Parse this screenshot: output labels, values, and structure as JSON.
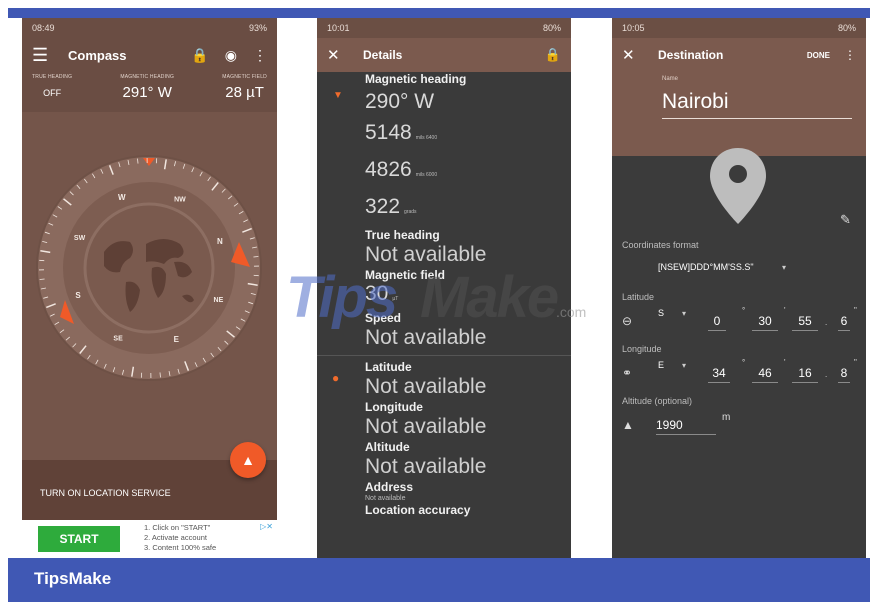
{
  "colors": {
    "frame_blue": "#4058b4",
    "compass_brown": "#74554a",
    "header_brown": "#7b5a4e",
    "dark_panel": "#3a3a3a",
    "accent_orange": "#f05a28",
    "ad_green": "#2eab3c"
  },
  "compass_screen": {
    "status": {
      "time": "08:49",
      "battery": "93%"
    },
    "appbar": {
      "title": "Compass",
      "menu_icon": "menu-icon",
      "lock_icon": "lock-icon",
      "pin_icon": "location-pin-icon",
      "more_icon": "more-icon"
    },
    "metrics": [
      {
        "label": "TRUE HEADING",
        "value": "OFF"
      },
      {
        "label": "MAGNETIC HEADING",
        "value": "291° W"
      },
      {
        "label": "MAGNETIC FIELD",
        "value": "28 µT"
      }
    ],
    "dial": {
      "heading_deg": 291,
      "cardinals": [
        "N",
        "NE",
        "E",
        "SE",
        "S",
        "SW",
        "W",
        "NW"
      ]
    },
    "location_banner": "TURN ON LOCATION SERVICE",
    "fab_icon": "navigation-arrow-icon",
    "ad": {
      "button": "START",
      "steps": [
        "1. Click on \"START\"",
        "2. Activate account",
        "3. Content 100% safe"
      ]
    }
  },
  "details_screen": {
    "status": {
      "time": "10:01",
      "battery": "80%"
    },
    "appbar": {
      "title": "Details",
      "close_icon": "close-icon",
      "lock_icon": "lock-icon"
    },
    "magnetic_heading": {
      "title": "Magnetic heading",
      "value": "290° W",
      "mils6400": "5148",
      "mils6400_unit": "mils 6400",
      "mils6000": "4826",
      "mils6000_unit": "mils 6000",
      "grads": "322",
      "grads_unit": "grads"
    },
    "true_heading": {
      "title": "True heading",
      "value": "Not available"
    },
    "magnetic_field": {
      "title": "Magnetic field",
      "value": "30",
      "unit": "µT"
    },
    "speed": {
      "title": "Speed",
      "value": "Not available"
    },
    "latitude": {
      "title": "Latitude",
      "value": "Not available"
    },
    "longitude": {
      "title": "Longitude",
      "value": "Not available"
    },
    "altitude": {
      "title": "Altitude",
      "value": "Not available"
    },
    "address": {
      "title": "Address",
      "value": "Not available"
    },
    "location_accuracy": {
      "title": "Location accuracy"
    }
  },
  "destination_screen": {
    "status": {
      "time": "10:05",
      "battery": "80%"
    },
    "appbar": {
      "title": "Destination",
      "done": "DONE",
      "close_icon": "close-icon",
      "more_icon": "more-icon"
    },
    "name_label": "Name",
    "name_value": "Nairobi",
    "coordinates_format_label": "Coordinates format",
    "coordinates_format_value": "[NSEW]DDD°MM'SS.S\"",
    "latitude": {
      "label": "Latitude",
      "dir": "S",
      "deg": "0",
      "min": "30",
      "sec": "55",
      "tenth": "6"
    },
    "longitude": {
      "label": "Longitude",
      "dir": "E",
      "deg": "34",
      "min": "46",
      "sec": "16",
      "tenth": "8"
    },
    "altitude": {
      "label": "Altitude (optional)",
      "value": "1990",
      "unit": "m"
    }
  },
  "watermark": {
    "tips": "Tips",
    "make": "Make",
    "com": ".com"
  },
  "footer_brand": "TipsMake"
}
